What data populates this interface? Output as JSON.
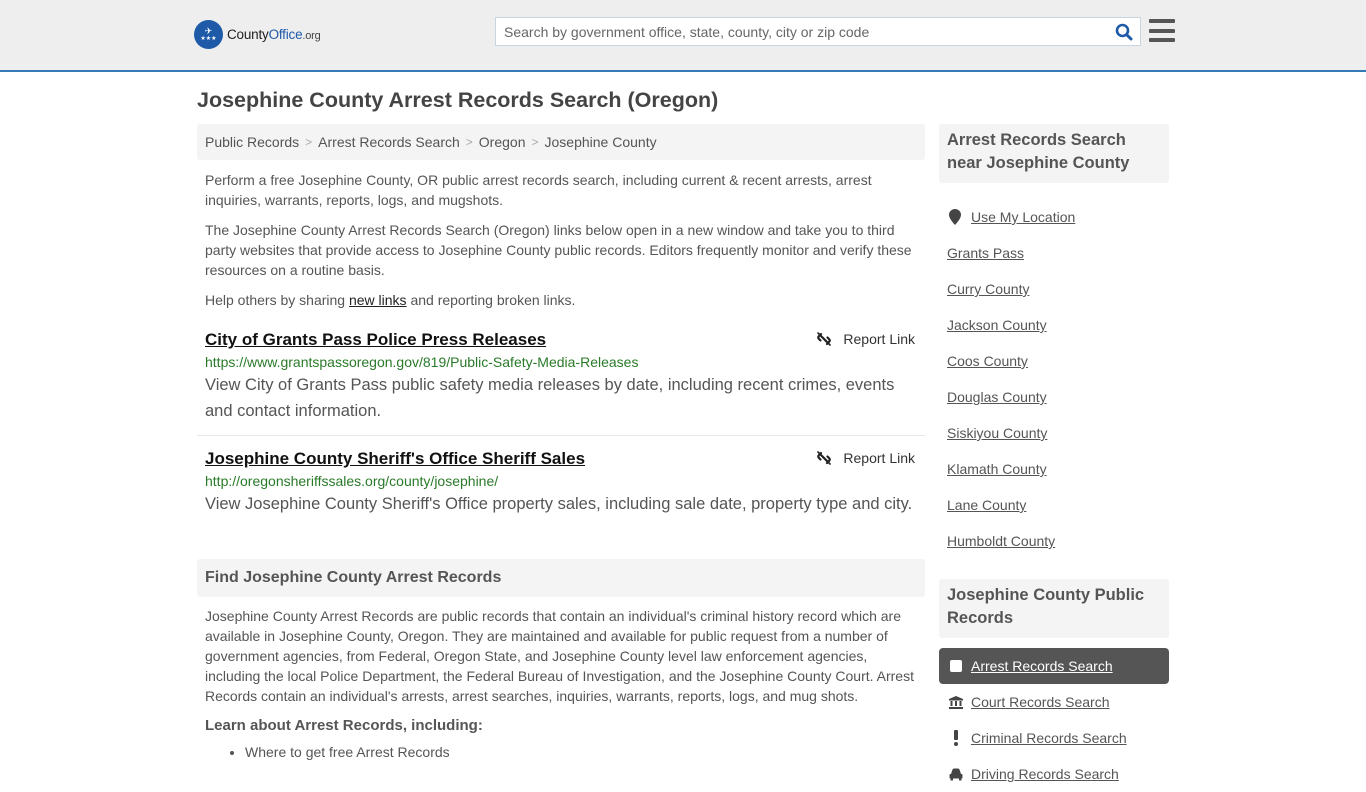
{
  "header": {
    "logo": {
      "name_part1": "County",
      "name_part2": "Office",
      "name_suffix": ".org"
    },
    "search": {
      "placeholder": "Search by government office, state, county, city or zip code",
      "value": ""
    },
    "colors": {
      "brand_blue": "#1e5aa8",
      "header_border": "#337ab7"
    }
  },
  "page_title": "Josephine County Arrest Records Search (Oregon)",
  "breadcrumb": [
    {
      "label": "Public Records"
    },
    {
      "label": "Arrest Records Search"
    },
    {
      "label": "Oregon"
    },
    {
      "label": "Josephine County"
    }
  ],
  "breadcrumb_separator": ">",
  "intro": {
    "p1": "Perform a free Josephine County, OR public arrest records search, including current & recent arrests, arrest inquiries, warrants, reports, logs, and mugshots.",
    "p2": "The Josephine County Arrest Records Search (Oregon) links below open in a new window and take you to third party websites that provide access to Josephine County public records. Editors frequently monitor and verify these resources on a routine basis.",
    "p3_before": "Help others by sharing ",
    "p3_link": "new links",
    "p3_after": " and reporting broken links."
  },
  "resources": [
    {
      "title": "City of Grants Pass Police Press Releases",
      "url": "https://www.grantspassoregon.gov/819/Public-Safety-Media-Releases",
      "description": "View City of Grants Pass public safety media releases by date, including recent crimes, events and contact information.",
      "report_label": "Report Link"
    },
    {
      "title": "Josephine County Sheriff's Office Sheriff Sales",
      "url": "http://oregonsheriffssales.org/county/josephine/",
      "description": "View Josephine County Sheriff's Office property sales, including sale date, property type and city.",
      "report_label": "Report Link"
    }
  ],
  "find_section": {
    "heading": "Find Josephine County Arrest Records",
    "body": "Josephine County Arrest Records are public records that contain an individual's criminal history record which are available in Josephine County, Oregon. They are maintained and available for public request from a number of government agencies, from Federal, Oregon State, and Josephine County level law enforcement agencies, including the local Police Department, the Federal Bureau of Investigation, and the Josephine County Court. Arrest Records contain an individual's arrests, arrest searches, inquiries, warrants, reports, logs, and mug shots.",
    "learn_heading": "Learn about Arrest Records, including:",
    "learn_items": [
      "Where to get free Arrest Records"
    ]
  },
  "sidebar": {
    "near": {
      "heading": "Arrest Records Search near Josephine County",
      "use_location": "Use My Location",
      "items": [
        "Grants Pass",
        "Curry County",
        "Jackson County",
        "Coos County",
        "Douglas County",
        "Siskiyou County",
        "Klamath County",
        "Lane County",
        "Humboldt County"
      ]
    },
    "public_records": {
      "heading": "Josephine County Public Records",
      "items": [
        {
          "label": "Arrest Records Search",
          "icon": "square-icon",
          "active": true
        },
        {
          "label": "Court Records Search",
          "icon": "courthouse-icon",
          "active": false
        },
        {
          "label": "Criminal Records Search",
          "icon": "exclamation-icon",
          "active": false
        },
        {
          "label": "Driving Records Search",
          "icon": "car-icon",
          "active": false
        }
      ]
    }
  }
}
